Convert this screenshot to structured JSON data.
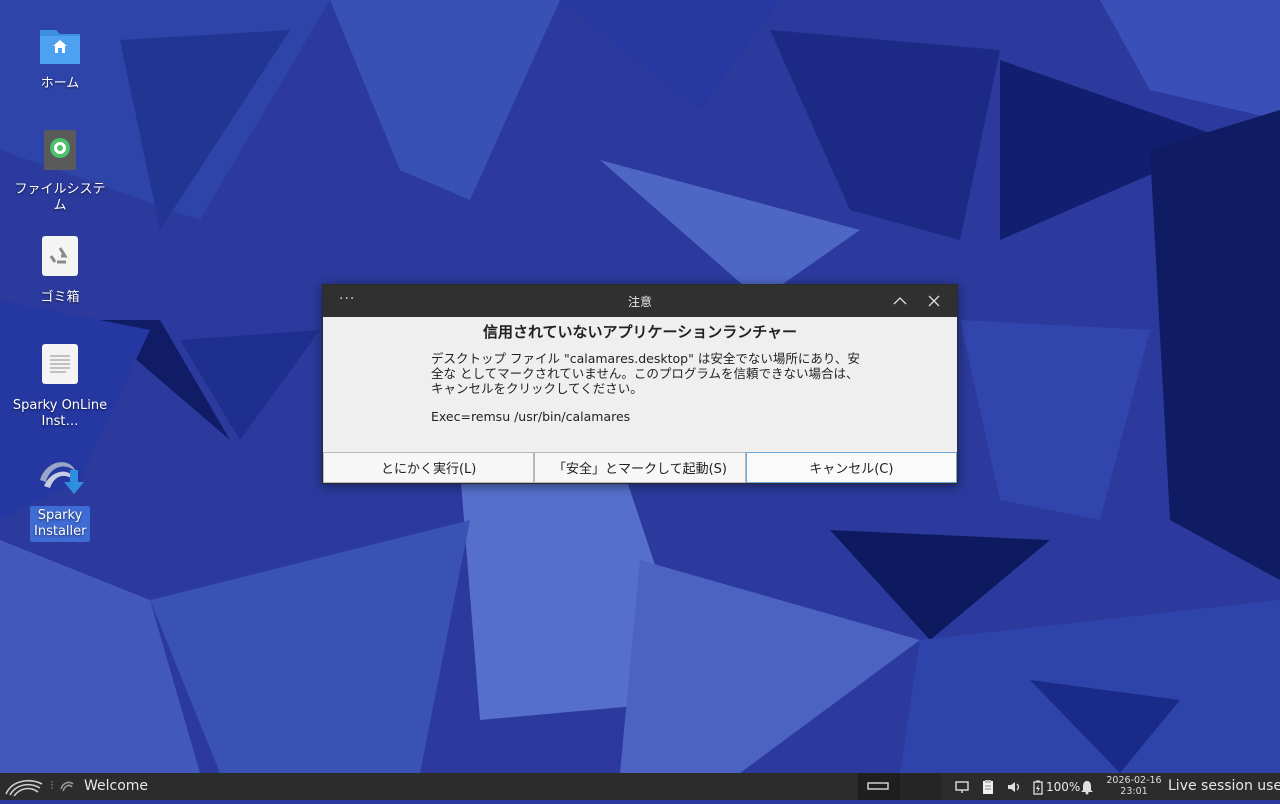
{
  "desktop": {
    "icons": [
      {
        "label": "ホーム",
        "icon": "home-folder-icon"
      },
      {
        "label": "ファイルシステム",
        "icon": "filesystem-icon"
      },
      {
        "label": "ゴミ箱",
        "icon": "trash-icon"
      },
      {
        "label": "Sparky OnLine Inst…",
        "icon": "document-icon"
      },
      {
        "label": "Sparky Installer",
        "icon": "installer-icon"
      }
    ]
  },
  "dialog": {
    "title": "注意",
    "menu_label": "···",
    "heading": "信用されていないアプリケーションランチャー",
    "body": "デスクトップ ファイル \"calamares.desktop\" は安全でない場所にあり、安全な としてマークされていません。このプログラムを信頼できない場合は、キャンセルをクリックしてください。",
    "exec": "Exec=remsu /usr/bin/calamares",
    "buttons": {
      "run_anyway": "とにかく実行(L)",
      "mark_safe": "「安全」とマークして起動(S)",
      "cancel": "キャンセル(C)"
    }
  },
  "taskbar": {
    "separator": "⁝",
    "active_window": "Welcome",
    "battery": "100%",
    "date": "2026-02-16",
    "time": "23:01",
    "user": "Live session user"
  },
  "colors": {
    "wallpaper_base": "#2b3a9c",
    "titlebar": "#303030",
    "dialog_bg": "#efefef",
    "taskbar": "#2c2c2c",
    "focus_border": "#6fa8dc",
    "selection": "#3f6bd4"
  }
}
